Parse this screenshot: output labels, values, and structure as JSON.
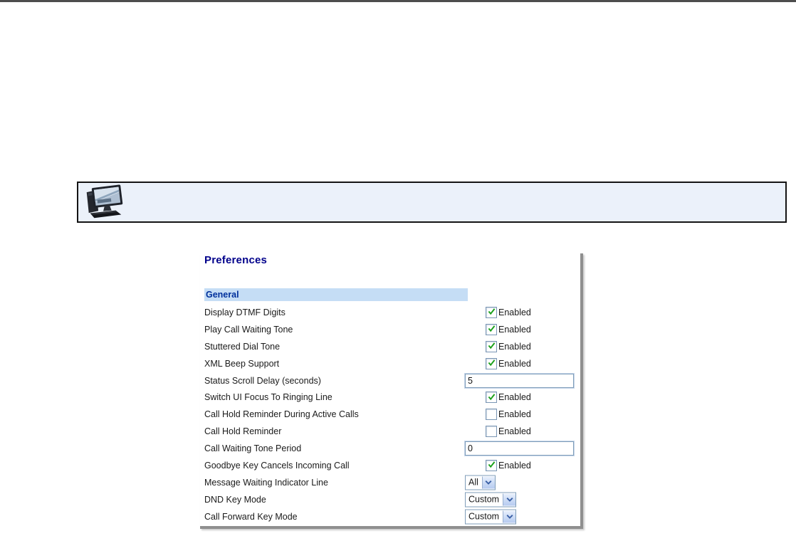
{
  "note_box": {
    "icon": "desktop-computer-icon"
  },
  "panel": {
    "title": "Preferences",
    "section": "General",
    "rows": [
      {
        "label": "Display DTMF Digits",
        "type": "checkbox",
        "checked": true,
        "value_label": "Enabled"
      },
      {
        "label": "Play Call Waiting Tone",
        "type": "checkbox",
        "checked": true,
        "value_label": "Enabled"
      },
      {
        "label": "Stuttered Dial Tone",
        "type": "checkbox",
        "checked": true,
        "value_label": "Enabled"
      },
      {
        "label": "XML Beep Support",
        "type": "checkbox",
        "checked": true,
        "value_label": "Enabled"
      },
      {
        "label": "Status Scroll Delay (seconds)",
        "type": "text",
        "value": "5"
      },
      {
        "label": "Switch UI Focus To Ringing Line",
        "type": "checkbox",
        "checked": true,
        "value_label": "Enabled"
      },
      {
        "label": "Call Hold Reminder During Active Calls",
        "type": "checkbox",
        "checked": false,
        "value_label": "Enabled"
      },
      {
        "label": "Call Hold Reminder",
        "type": "checkbox",
        "checked": false,
        "value_label": "Enabled"
      },
      {
        "label": "Call Waiting Tone Period",
        "type": "text",
        "value": "0"
      },
      {
        "label": "Goodbye Key Cancels Incoming Call",
        "type": "checkbox",
        "checked": true,
        "value_label": "Enabled"
      },
      {
        "label": "Message Waiting Indicator Line",
        "type": "select",
        "value": "All"
      },
      {
        "label": "DND Key Mode",
        "type": "select",
        "value": "Custom"
      },
      {
        "label": "Call Forward Key Mode",
        "type": "select",
        "value": "Custom"
      }
    ]
  },
  "colors": {
    "title_navy": "#00008b",
    "section_bg": "#c5ddf5",
    "section_fg": "#00309c",
    "check_green": "#1ca11c",
    "control_border": "#7f9db9",
    "panel_shadow": "#8f8f8f",
    "note_bg": "#ebf1fa",
    "top_rule": "#4d4d4d"
  }
}
